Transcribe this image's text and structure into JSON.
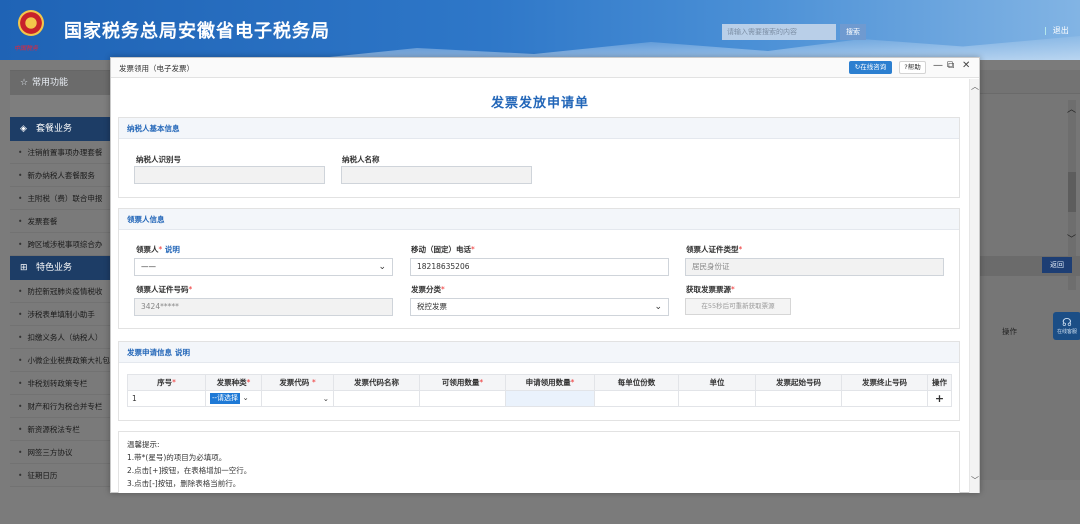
{
  "header": {
    "logo_sub": "中国税务",
    "title": "国家税务总局安徽省电子税务局",
    "search_placeholder": "请输入需要搜索的内容",
    "search_button": "搜索",
    "logout": "退出"
  },
  "sidebar": {
    "common_header": "常用功能",
    "package_header": "套餐业务",
    "package_items": [
      "注销前置事项办理套餐",
      "新办纳税人套餐服务",
      "主附税（费）联合申报",
      "发票套餐",
      "跨区域涉税事项综合办"
    ],
    "special_header": "特色业务",
    "special_items": [
      "防控新冠肺炎疫情税收",
      "涉税表单填制小助手",
      "扣缴义务人（纳税人）",
      "小微企业税费政策大礼包",
      "非税划转政策专栏",
      "财产和行为税合并专栏",
      "新资源税法专栏",
      "网签三方协议",
      "征期日历"
    ]
  },
  "right_pane": {
    "back_button": "返回",
    "op_label": "操作",
    "float_label": "在线客服"
  },
  "modal": {
    "title": "发票领用（电子发票）",
    "online_btn": "在线咨询",
    "help_btn": "帮助",
    "form_title": "发票发放申请单",
    "taxpayer": {
      "header": "纳税人基本信息",
      "id_label": "纳税人识别号",
      "name_label": "纳税人名称",
      "id_value": "",
      "name_value": ""
    },
    "recipient": {
      "header": "领票人信息",
      "person_label": "领票人",
      "person_note": "说明",
      "person_value": "——",
      "phone_label": "移动（固定）电话",
      "phone_value": "18218635206",
      "id_type_label": "领票人证件类型",
      "id_type_value": "居民身份证",
      "id_no_label": "领票人证件号码",
      "id_no_value": "3424*****",
      "category_label": "发票分类",
      "category_value": "税控发票",
      "source_label": "获取发票票源",
      "source_button": "在55秒后可重新获取票源"
    },
    "application": {
      "header": "发票申请信息",
      "header_note": "说明",
      "columns": [
        "序号",
        "发票种类",
        "发票代码",
        "发票代码名称",
        "可领用数量",
        "申请领用数量",
        "每单位份数",
        "单位",
        "发票起始号码",
        "发票终止号码",
        "操作"
      ],
      "row": {
        "seq": "1",
        "type_value": "--请选择",
        "add": "+"
      }
    },
    "tips": {
      "title": "温馨提示:",
      "lines": [
        "1.带*(星号)的项目为必填项。",
        "2.点击[+]按钮，在表格增加一空行。",
        "3.点击[-]按钮，删除表格当前行。"
      ]
    }
  }
}
